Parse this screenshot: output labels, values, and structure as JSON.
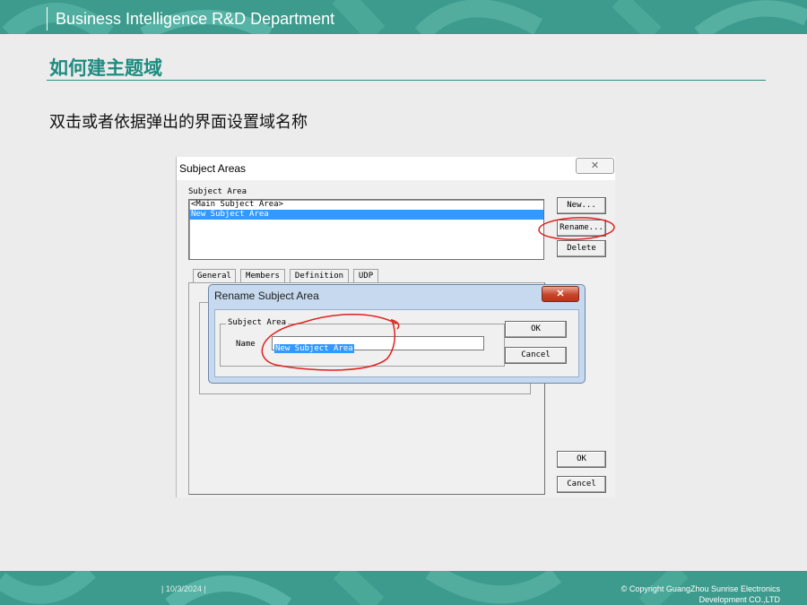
{
  "header": {
    "department": "Business Intelligence R&D Department"
  },
  "slide": {
    "title": "如何建主题域",
    "body": "双击或者依据弹出的界面设置域名称"
  },
  "screenshot": {
    "window_title": "Subject Areas",
    "close_glyph": "✕",
    "subject_area_label": "Subject Area",
    "subject_areas": [
      "<Main Subject Area>",
      "New Subject Area"
    ],
    "selected_index": 1,
    "buttons": {
      "new": "New...",
      "rename": "Rename...",
      "delete": "Delete",
      "ok": "OK",
      "cancel": "Cancel"
    },
    "tabs": [
      "General",
      "Members",
      "Definition",
      "UDP"
    ],
    "rename_dialog": {
      "title": "Rename Subject Area",
      "close_glyph": "✕",
      "group_label": "Subject Area",
      "name_label": "Name",
      "name_value": "New Subject Area",
      "ok": "OK",
      "cancel": "Cancel"
    },
    "annotation_color": "#e0201c"
  },
  "footer": {
    "date": "| 10/3/2024 |",
    "copyright_line1": "© Copyright GuangZhou Sunrise Electronics",
    "copyright_line2": "Development CO.,LTD"
  },
  "colors": {
    "brand_teal": "#3d9b8d",
    "title_teal": "#1e8b80",
    "selection_blue": "#3399ff"
  }
}
